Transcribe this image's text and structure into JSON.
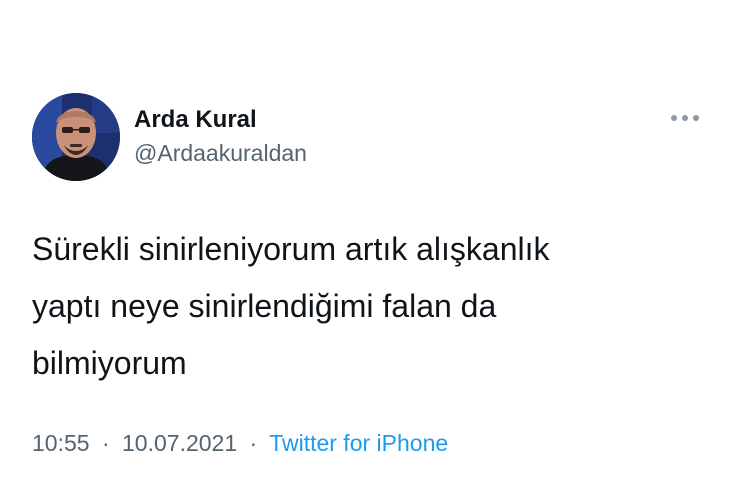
{
  "author": {
    "display_name": "Arda Kural",
    "handle": "@Ardaakuraldan"
  },
  "tweet": {
    "text_lines": [
      "Sürekli sinirleniyorum artık alışkanlık",
      "yaptı neye sinirlendiğimi falan da",
      "bilmiyorum"
    ]
  },
  "meta": {
    "time": "10:55",
    "separator": "·",
    "date": "10.07.2021",
    "source": "Twitter for iPhone"
  },
  "icons": {
    "more": "more-horizontal-icon",
    "avatar": "profile-avatar"
  },
  "colors": {
    "text": "#0f1419",
    "secondary": "#536471",
    "link": "#1d9bf0"
  }
}
